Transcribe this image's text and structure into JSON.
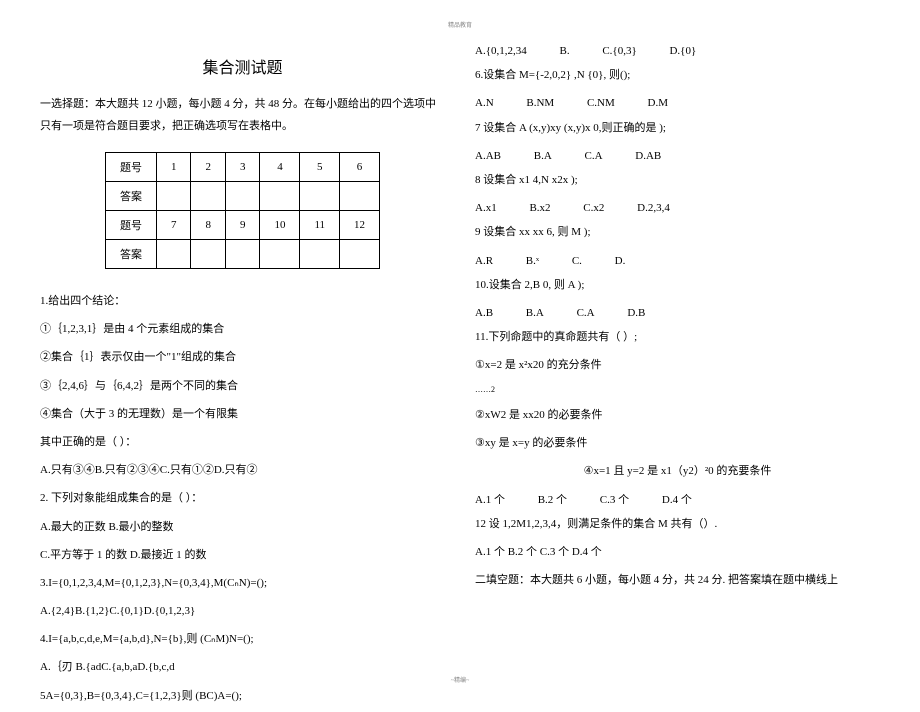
{
  "header": "精品教育",
  "footer": "~精编~",
  "title": "集合测试题",
  "intro": "一选择题：本大题共 12 小题，每小题 4 分，共 48 分。在每小题给出的四个选项中只有一项是符合题目要求，把正确选项写在表格中。",
  "table": {
    "row1_label": "题号",
    "row1": [
      "1",
      "2",
      "3",
      "4",
      "5",
      "6"
    ],
    "row2_label": "答案",
    "row3_label": "题号",
    "row3": [
      "7",
      "8",
      "9",
      "10",
      "11",
      "12"
    ],
    "row4_label": "答案"
  },
  "left": {
    "q1": "1.给出四个结论：",
    "q1_a": "①｛1,2,3,1｝是由 4 个元素组成的集合",
    "q1_b": "②集合｛1｝表示仅由一个\"1\"组成的集合",
    "q1_c": "③｛2,4,6｝与｛6,4,2｝是两个不同的集合",
    "q1_d": "④集合（大于 3 的无理数）是一个有限集",
    "q1_e": "其中正确的是（  ）：",
    "q1_opts": "A.只有③④B.只有②③④C.只有①②D.只有②",
    "q2": "2. 下列对象能组成集合的是（  ）：",
    "q2_opts1": "A.最大的正数 B.最小的整数",
    "q2_opts2": "C.平方等于 1 的数 D.最接近 1 的数",
    "q3": "3.I={0,1,2,3,4,M={0,1,2,3},N={0,3,4},M(CₙN)=();",
    "q3_opts": "A.{2,4}B.{1,2}C.{0,1}D.{0,1,2,3}",
    "q4": "4.I={a,b,c,d,e,M={a,b,d},N={b},则 (CₙM)N=();",
    "q4_opts": "A.｛刃 B.{adC.{a,b,aD.{b,c,d",
    "q5": "5A={0,3},B={0,3,4},C={1,2,3}则 (BC)A=();"
  },
  "right": {
    "q5_opts": {
      "a": "A.{0,1,2,34",
      "b": "B.",
      "c": "C.{0,3}",
      "d": "D.{0}"
    },
    "q6": "6.设集合 M={-2,0,2}          ,N             {0}, 则();",
    "q6_opts": {
      "a": "A.N",
      "b": "B.NM",
      "c": "C.NM",
      "d": "D.M"
    },
    "q7": "7 设集合 A       (x,y)xy                    (x,y)x                      0,则正确的是         );",
    "q7_opts": {
      "a": "A.AB",
      "b": "B.A",
      "c": "C.A",
      "d": "D.AB"
    },
    "q8": "8 设集合             x1          4,N          x2x                               );",
    "q8_opts": {
      "a": "A.x1",
      "b": "B.x2",
      "c": "C.x2",
      "d": "D.2,3,4"
    },
    "q9": "9 设集合           xx                    xx    6, 则 M                  );",
    "q9_opts": {
      "a": "A.R",
      "b": "B.ˣ",
      "c": "C.",
      "d": "D."
    },
    "q10": "10.设集合                        2,B                         0, 则 A               );",
    "q10_opts": {
      "a": "A.B",
      "b": "B.A",
      "c": "C.A",
      "d": "D.B"
    },
    "q11": "11.下列命题中的真命题共有（       ）;",
    "q11_a": "①x=2 是 x²x20 的充分条件",
    "q11_sep": "……2",
    "q11_b": "②xW2 是 xx20 的必要条件",
    "q11_c": "③xy 是 x=y 的必要条件",
    "q11_d": "④x=1 且 y=2 是 x1（y2）²0 的充要条件",
    "q11_opts": {
      "a": "A.1 个",
      "b": "B.2 个",
      "c": "C.3 个",
      "d": "D.4 个"
    },
    "q12": "12 设 1,2M1,2,3,4，则满足条件的集合 M 共有（）.",
    "q12_opts": "A.1 个 B.2 个 C.3 个 D.4 个",
    "section2": "二填空题：本大题共 6 小题，每小题 4 分，共 24 分. 把答案填在题中横线上"
  }
}
